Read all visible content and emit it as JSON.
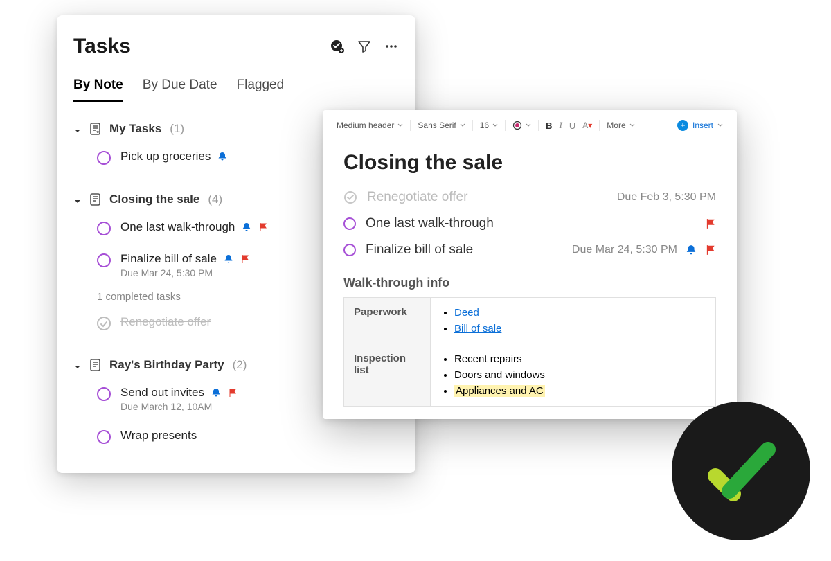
{
  "tasks_panel": {
    "title": "Tasks",
    "tabs": [
      "By Note",
      "By Due Date",
      "Flagged"
    ],
    "active_tab_index": 0,
    "groups": [
      {
        "name": "My Tasks",
        "count": "(1)",
        "tasks": [
          {
            "label": "Pick up groceries",
            "reminder": true
          }
        ]
      },
      {
        "name": "Closing the sale",
        "count": "(4)",
        "tasks": [
          {
            "label": "One last walk-through",
            "reminder": true,
            "flagged": true
          },
          {
            "label": "Finalize bill of sale",
            "reminder": true,
            "flagged": true,
            "sub": "Due Mar 24, 5:30 PM"
          }
        ],
        "completed_summary": "1 completed tasks",
        "completed": [
          {
            "label": "Renegotiate offer"
          }
        ]
      },
      {
        "name": "Ray's Birthday Party",
        "count": "(2)",
        "tasks": [
          {
            "label": "Send out invites",
            "reminder": true,
            "flagged": true,
            "sub": "Due March 12, 10AM"
          },
          {
            "label": "Wrap presents"
          }
        ]
      }
    ]
  },
  "editor": {
    "toolbar": {
      "text_style": "Medium header",
      "font": "Sans Serif",
      "size": "16",
      "more_label": "More",
      "insert_label": "Insert"
    },
    "title": "Closing the sale",
    "tasks": [
      {
        "label": "Renegotiate offer",
        "done": true,
        "due": "Due Feb 3, 5:30 PM"
      },
      {
        "label": "One last walk-through",
        "flagged": true
      },
      {
        "label": "Finalize bill of sale",
        "due": "Due Mar 24, 5:30 PM",
        "reminder": true,
        "flagged": true
      }
    ],
    "section_heading": "Walk-through info",
    "table": [
      {
        "header": "Paperwork",
        "items": [
          {
            "text": "Deed",
            "link": true
          },
          {
            "text": "Bill of sale",
            "link": true
          }
        ]
      },
      {
        "header": "Inspection list",
        "items": [
          {
            "text": "Recent repairs"
          },
          {
            "text": "Doors and windows"
          },
          {
            "text": "Appliances and AC",
            "highlight": true
          }
        ]
      }
    ]
  },
  "colors": {
    "accent_purple": "#a64fd6",
    "reminder_blue": "#0b6fd8",
    "flag_red": "#e33b2e",
    "check_green_dark": "#2aa83a",
    "check_green_light": "#b8d82e"
  }
}
